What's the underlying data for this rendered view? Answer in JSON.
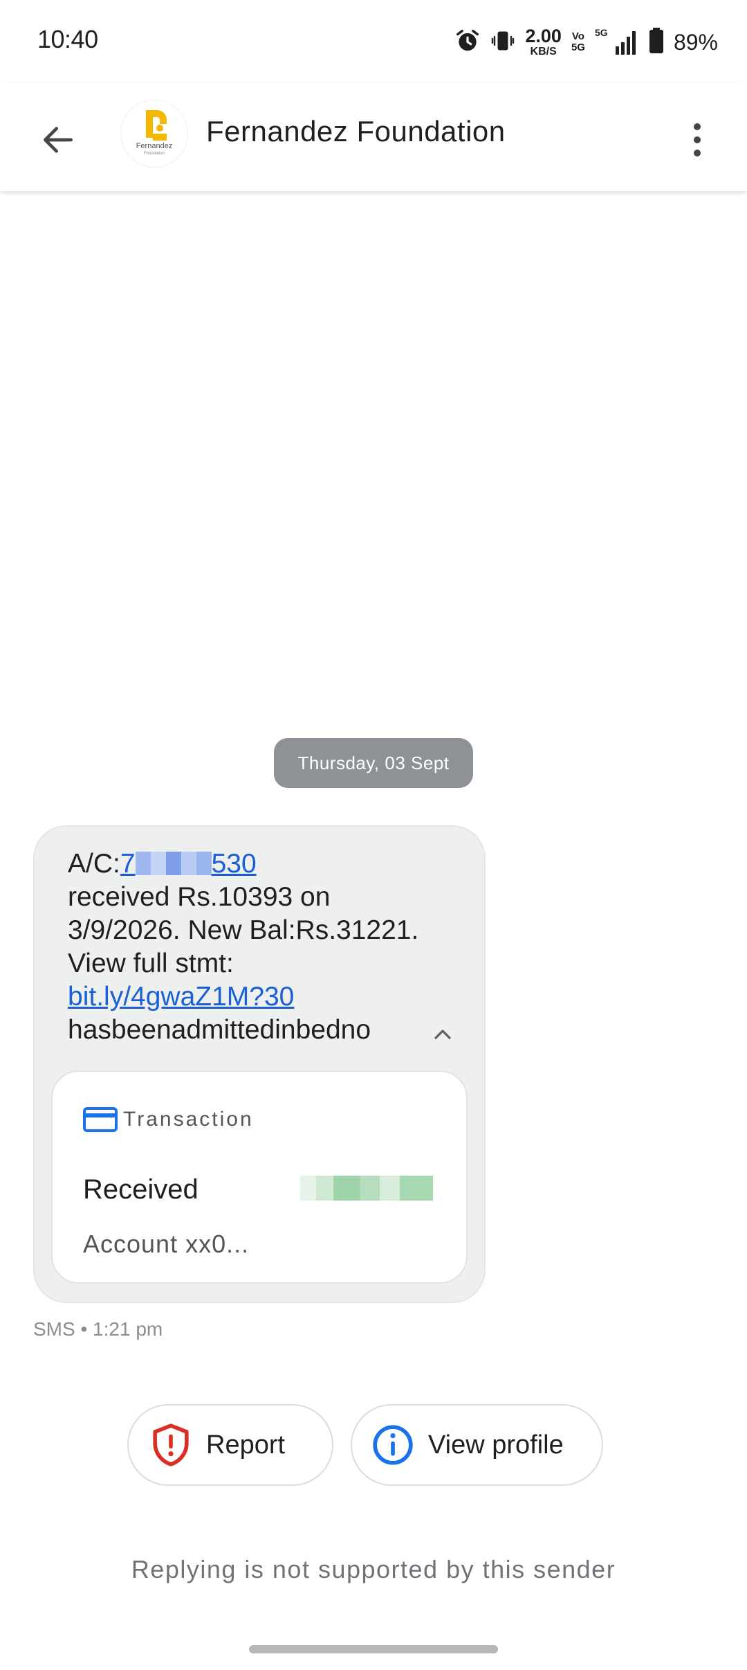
{
  "status_bar": {
    "time": "10:40",
    "net_speed_value": "2.00",
    "net_speed_unit": "KB/S",
    "volte_top": "Vo",
    "volte_bottom": "5G",
    "network": "5G",
    "battery_percent": "89%"
  },
  "header": {
    "title": "Fernandez Foundation",
    "avatar_logo_text": "Fernandez",
    "avatar_logo_subtext": "Foundation"
  },
  "conversation": {
    "date_chip": "Thursday, 03 Sept",
    "message": {
      "acct_prefix": "A/C:",
      "acct_visible_start": "7",
      "acct_visible_end": "530",
      "body_part1": "received Rs.10393 on 3/9/2026. New Bal:Rs.31221. View full stmt: ",
      "link": "bit.ly/4gwaZ1M?30",
      "body_part2": "hasbeenadmittedinbedno",
      "transaction": {
        "header": "Transaction",
        "status": "Received",
        "account": "Account xx0..."
      },
      "timestamp": "SMS • 1:21 pm"
    }
  },
  "actions": {
    "report_label": "Report",
    "view_profile_label": "View profile"
  },
  "footer": {
    "reply_note": "Replying is not supported by this sender"
  },
  "colors": {
    "link": "#1a5fd6",
    "bubble_bg": "#eef0f0",
    "date_chip_bg": "#8e9196",
    "report_red": "#d93025",
    "info_blue": "#1a73e8",
    "logo_yellow": "#f5b800"
  },
  "icons": {
    "back": "arrow-left-icon",
    "more": "more-vertical-icon",
    "collapse": "chevron-up-icon",
    "transaction": "credit-card-icon",
    "report": "shield-alert-icon",
    "profile": "info-icon",
    "alarm": "alarm-icon",
    "vibrate": "vibrate-icon",
    "signal": "signal-icon",
    "battery": "battery-icon"
  }
}
